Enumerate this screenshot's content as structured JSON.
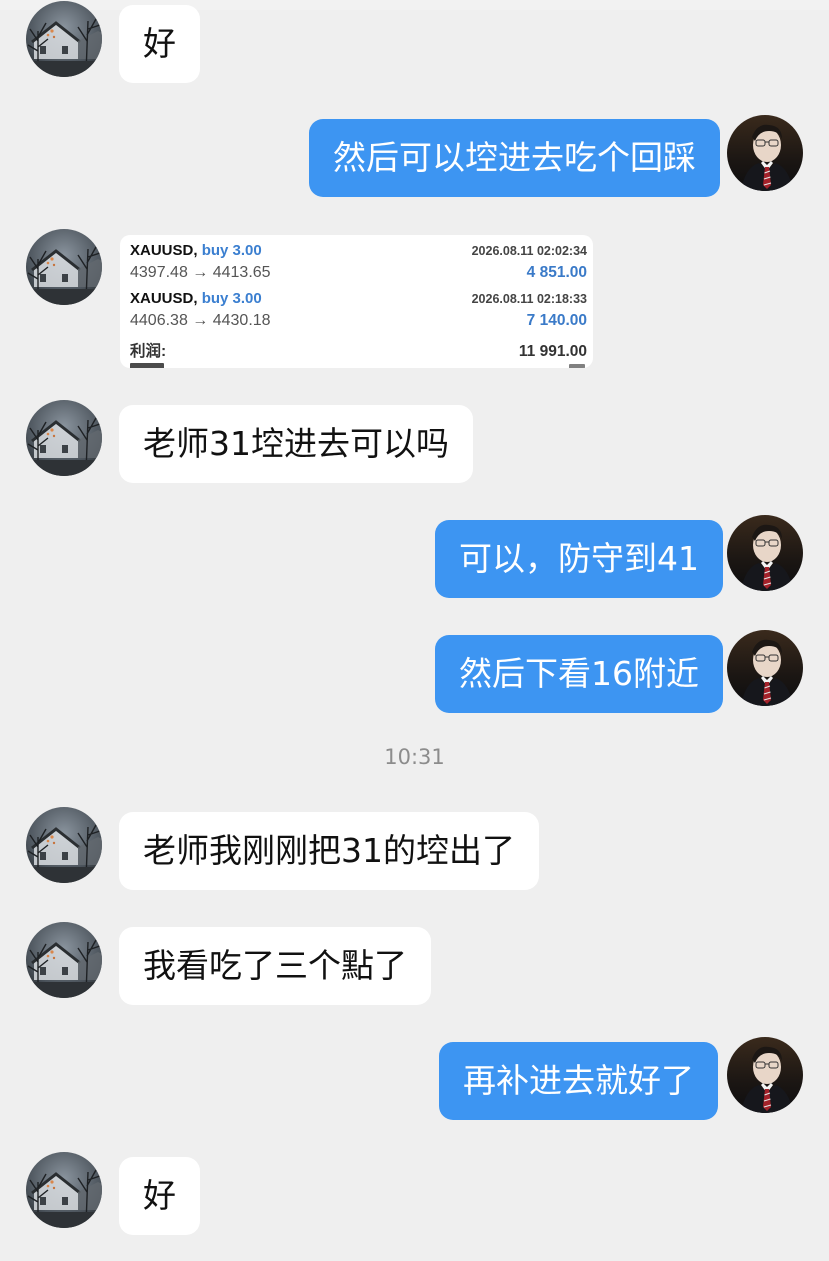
{
  "messages": [
    {
      "side": "left",
      "text": "好"
    },
    {
      "side": "right",
      "text": "然后可以埪进去吃个回踩"
    },
    {
      "side": "left",
      "type": "trade_card"
    },
    {
      "side": "left",
      "text": "老师31埪进去可以吗"
    },
    {
      "side": "right",
      "text": "可以，防守到41"
    },
    {
      "side": "right",
      "text": "然后下看16附近"
    },
    {
      "side": "left",
      "text": "老师我刚刚把31的埪出了"
    },
    {
      "side": "left",
      "text": "我看吃了三个點了"
    },
    {
      "side": "right",
      "text": "再补进去就好了"
    },
    {
      "side": "left",
      "text": "好"
    }
  ],
  "timestamp": "10:31",
  "trade_card": {
    "trades": [
      {
        "symbol": "XAUUSD,",
        "action": "buy 3.00",
        "datetime": "2026.08.11 02:02:34",
        "prices": "4397.48 → 4413.65",
        "profit": "4 851.00"
      },
      {
        "symbol": "XAUUSD,",
        "action": "buy 3.00",
        "datetime": "2026.08.11 02:18:33",
        "prices": "4406.38 → 4430.18",
        "profit": "7 140.00"
      }
    ],
    "total_label": "利润:",
    "total_value": "11 991.00"
  },
  "colors": {
    "background": "#efefef",
    "left_bubble": "#ffffff",
    "right_bubble": "#3d95f2",
    "timestamp": "#8c8c8c",
    "trade_action": "#3b7fd0",
    "trade_profit": "#3a7ac8"
  },
  "icons": {
    "left_avatar": "house-night-avatar",
    "right_avatar": "man-in-suit-avatar"
  }
}
